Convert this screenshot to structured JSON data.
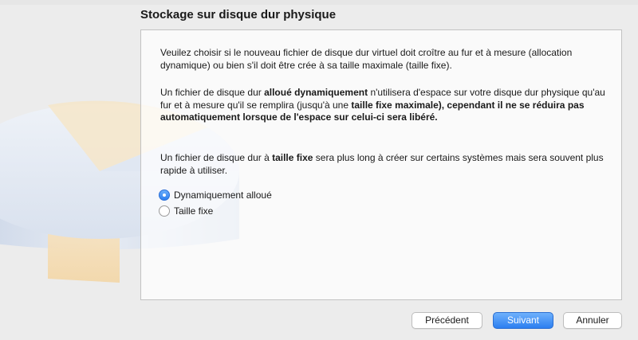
{
  "dialog": {
    "title": "Stockage sur disque dur physique"
  },
  "content": {
    "paragraph1": "Veuilez choisir si le nouveau fichier de disque dur virtuel doit croître au fur et à mesure (allocation dynamique) ou bien s'il doit être crée à sa taille maximale (taille fixe).",
    "paragraph2": {
      "t1": "Un fichier de disque dur ",
      "b1": "alloué dynamiquement",
      "t2": " n'utilisera d'espace sur votre disque dur physique qu'au fur et à mesure qu'il se remplira (jusqu'à une ",
      "b2": "taille fixe maximale), cependant il ne se réduira pas automatiquement lorsque de l'espace sur celui-ci sera libéré."
    },
    "paragraph3": {
      "t1": "Un fichier de disque dur à ",
      "b1": "taille fixe",
      "t2": " sera plus long à créer sur certains systèmes mais sera souvent plus rapide à utiliser."
    }
  },
  "options": [
    {
      "label": "Dynamiquement alloué",
      "selected": true
    },
    {
      "label": "Taille fixe",
      "selected": false
    }
  ],
  "buttons": {
    "previous": "Précédent",
    "next": "Suivant",
    "cancel": "Annuler"
  },
  "colors": {
    "accent": "#3b8cf5",
    "background": "#ececec"
  },
  "icons": {
    "watermark": "disk-pie-chart-watermark"
  }
}
